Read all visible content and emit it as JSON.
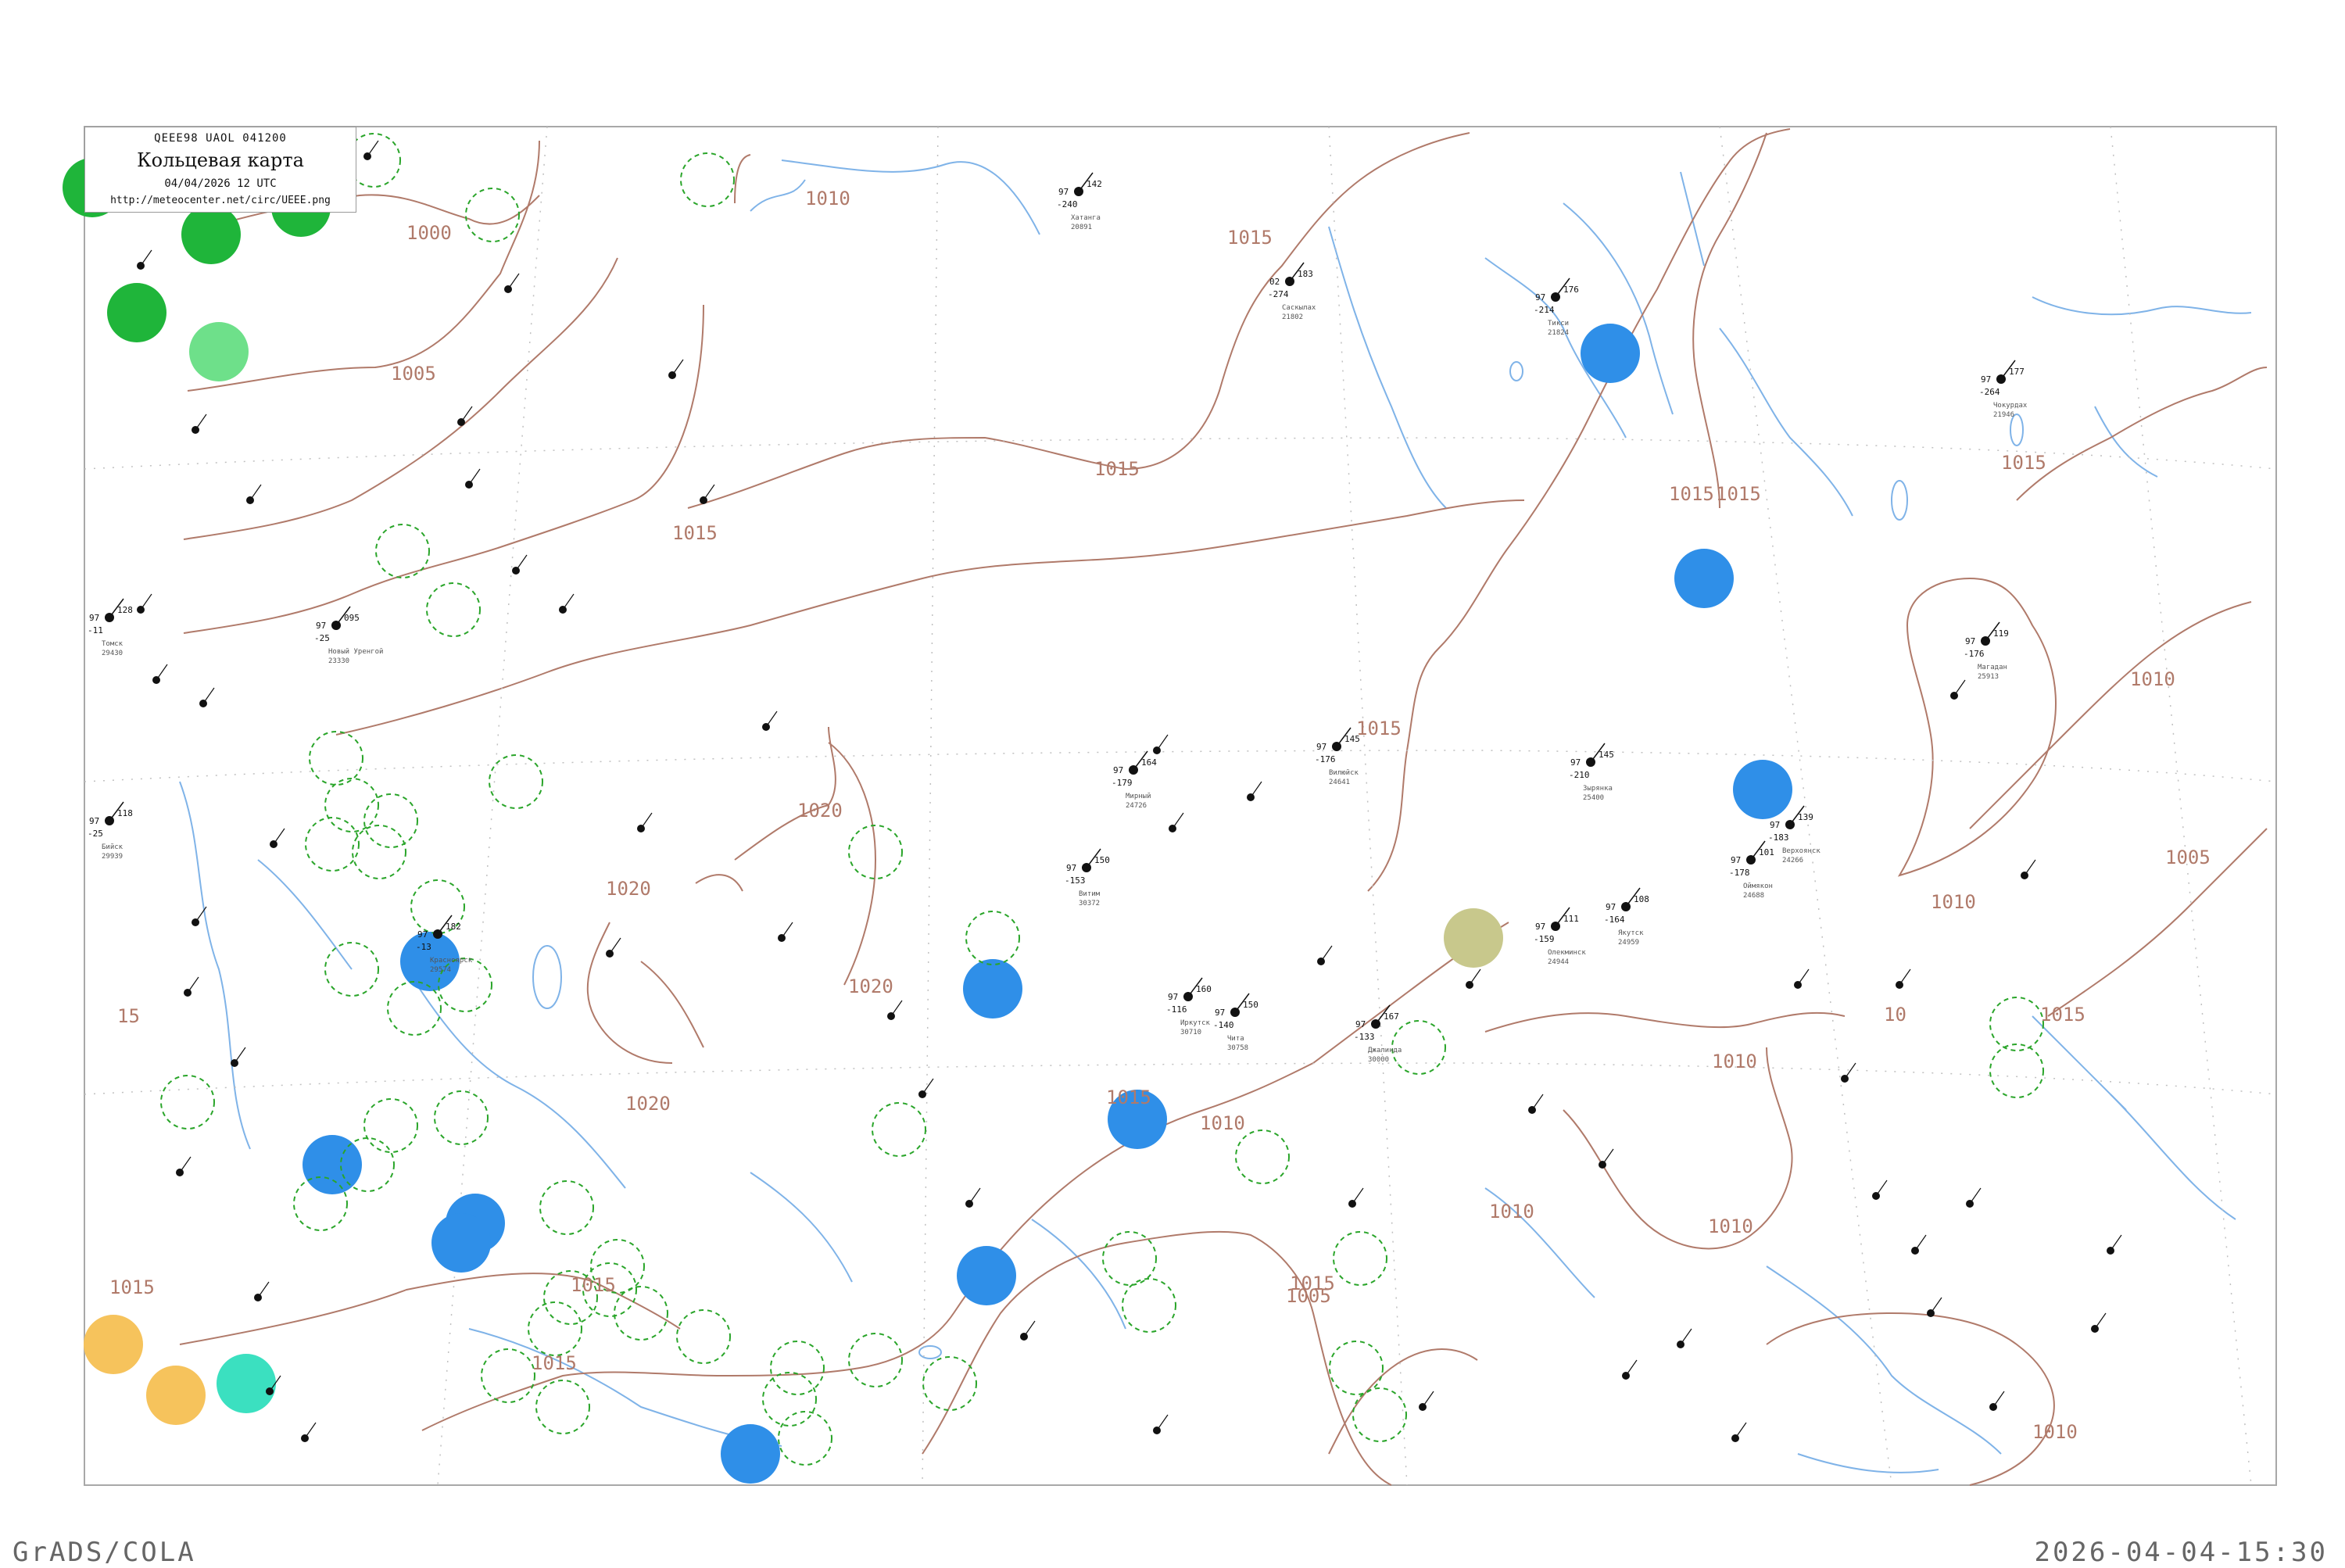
{
  "legend": {
    "line1": "QEEE98  UAOL  041200",
    "line2": "Кольцевая карта",
    "line3": "04/04/2026 12 UTC",
    "line4": "http://meteocenter.net/circ/UEEE.png"
  },
  "footer": {
    "left": "GrADS/COLA",
    "right": "2026-04-04-15:30"
  },
  "colors": {
    "isobar": "#b07a6a",
    "river": "#7fb3e8",
    "frame": "#a8a8a8",
    "ring": "#2aa52a",
    "blue_zone": "#2f8fe8",
    "green_zone": "#1fb53a",
    "light_green_zone": "#6ee08a",
    "teal_zone": "#3be0c0",
    "orange_zone": "#f6c35c",
    "olive_zone": "#c8c88c"
  },
  "isobar_labels": [
    {
      "text": "1000"
    },
    {
      "text": "1005"
    },
    {
      "text": "1010"
    },
    {
      "text": "1015"
    },
    {
      "text": "1015"
    },
    {
      "text": "1015"
    },
    {
      "text": "1015"
    },
    {
      "text": "1015"
    },
    {
      "text": "1015"
    },
    {
      "text": "1015"
    },
    {
      "text": "1015"
    },
    {
      "text": "1015"
    },
    {
      "text": "1015"
    },
    {
      "text": "1015"
    },
    {
      "text": "1015"
    },
    {
      "text": "1020"
    },
    {
      "text": "1020"
    },
    {
      "text": "1020"
    },
    {
      "text": "1020"
    },
    {
      "text": "1010"
    },
    {
      "text": "1010"
    },
    {
      "text": "1010"
    },
    {
      "text": "1010"
    },
    {
      "text": "1010"
    },
    {
      "text": "1010"
    },
    {
      "text": "1010"
    },
    {
      "text": "1005"
    },
    {
      "text": "1005"
    },
    {
      "text": "1015"
    },
    {
      "text": "15"
    },
    {
      "text": "10"
    }
  ],
  "colored_zones": [
    {
      "color": "#1fb53a"
    },
    {
      "color": "#1fb53a"
    },
    {
      "color": "#1fb53a"
    },
    {
      "color": "#1fb53a"
    },
    {
      "color": "#6ee08a"
    },
    {
      "color": "#2f8fe8"
    },
    {
      "color": "#2f8fe8"
    },
    {
      "color": "#2f8fe8"
    },
    {
      "color": "#2f8fe8"
    },
    {
      "color": "#2f8fe8"
    },
    {
      "color": "#2f8fe8"
    },
    {
      "color": "#2f8fe8"
    },
    {
      "color": "#2f8fe8"
    },
    {
      "color": "#2f8fe8"
    },
    {
      "color": "#2f8fe8"
    },
    {
      "color": "#2f8fe8"
    },
    {
      "color": "#c8c88c"
    },
    {
      "color": "#f6c35c"
    },
    {
      "color": "#f6c35c"
    },
    {
      "color": "#3be0c0"
    }
  ],
  "stations": [
    {
      "name": "Новый Уренгой",
      "id": "23330",
      "p": "095",
      "t": "97",
      "d": "-25"
    },
    {
      "name": "Бийск",
      "id": "29939",
      "p": "118",
      "t": "97",
      "d": "-25"
    },
    {
      "name": "Хатанга",
      "id": "20891",
      "p": "142",
      "t": "97",
      "d": "-240"
    },
    {
      "name": "Саскылах",
      "id": "21802",
      "p": "183",
      "t": "02",
      "d": "-274"
    },
    {
      "name": "Джалинда",
      "id": "30000",
      "p": "167",
      "t": "97",
      "d": "-133"
    },
    {
      "name": "Тикси",
      "id": "21824",
      "p": "176",
      "t": "97",
      "d": "-214"
    },
    {
      "name": "Чокурдах",
      "id": "21946",
      "p": "177",
      "t": "97",
      "d": "-264"
    },
    {
      "name": "Мирный",
      "id": "24726",
      "p": "164",
      "t": "97",
      "d": "-179"
    },
    {
      "name": "Витим",
      "id": "30372",
      "p": "150",
      "t": "97",
      "d": "-153"
    },
    {
      "name": "Олекминск",
      "id": "24944",
      "p": "111",
      "t": "97",
      "d": "-159"
    },
    {
      "name": "Якутск",
      "id": "24959",
      "p": "108",
      "t": "97",
      "d": "-164"
    },
    {
      "name": "Оймякон",
      "id": "24688",
      "p": "101",
      "t": "97",
      "d": "-178"
    },
    {
      "name": "Томск",
      "id": "29430",
      "p": "128",
      "t": "97",
      "d": "-11"
    },
    {
      "name": "Красноярск",
      "id": "29574",
      "p": "182",
      "t": "97",
      "d": "-13"
    },
    {
      "name": "Иркутск",
      "id": "30710",
      "p": "160",
      "t": "97",
      "d": "-116"
    },
    {
      "name": "Чита",
      "id": "30758",
      "p": "150",
      "t": "97",
      "d": "-140"
    },
    {
      "name": "Магадан",
      "id": "25913",
      "p": "119",
      "t": "97",
      "d": "-176"
    },
    {
      "name": "Зырянка",
      "id": "25400",
      "p": "145",
      "t": "97",
      "d": "-210"
    },
    {
      "name": "Верхоянск",
      "id": "24266",
      "p": "139",
      "t": "97",
      "d": "-183"
    },
    {
      "name": "Вилюйск",
      "id": "24641",
      "p": "145",
      "t": "97",
      "d": "-176"
    }
  ]
}
